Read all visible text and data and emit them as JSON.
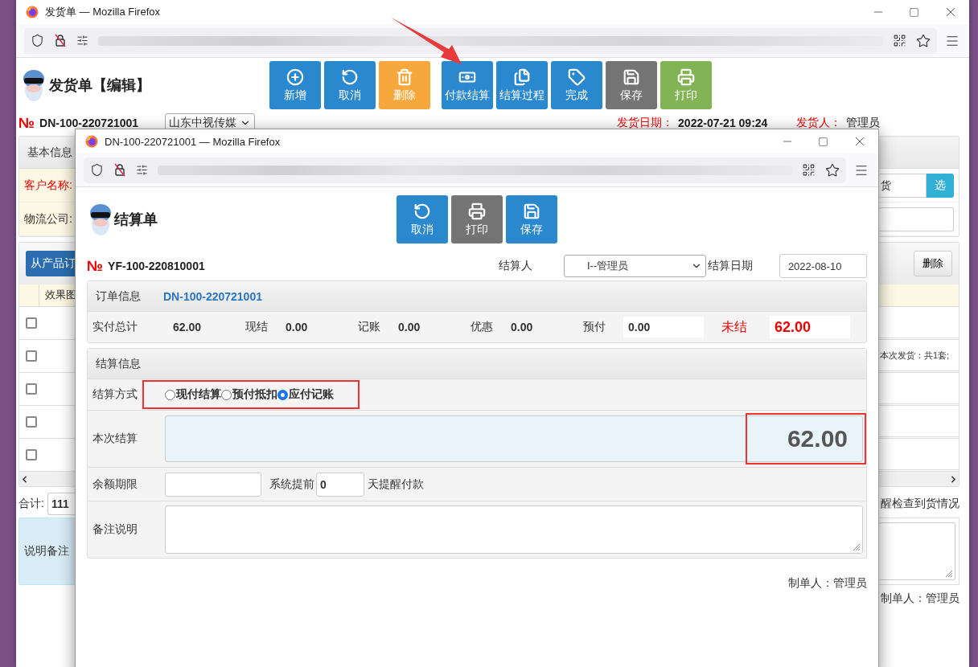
{
  "main_window": {
    "title": "发货单 — Mozilla Firefox",
    "page_title": "发货单【编辑】",
    "toolbar": [
      {
        "label": "新增",
        "color": "#2a88cf"
      },
      {
        "label": "取消",
        "color": "#2a88cf"
      },
      {
        "label": "删除",
        "color": "#f7a83c"
      },
      {
        "label": "付款结算",
        "color": "#2a88cf"
      },
      {
        "label": "结算过程",
        "color": "#2a88cf"
      },
      {
        "label": "完成",
        "color": "#2a88cf"
      },
      {
        "label": "保存",
        "color": "#747474"
      },
      {
        "label": "打印",
        "color": "#82b455"
      }
    ],
    "no_sign": "№",
    "number": "DN-100-220721001",
    "customer_select": "山东中视传媒",
    "ship_date_label": "发货日期：",
    "ship_date": "2022-07-21 09:24",
    "shipper_label": "发货人：",
    "shipper": "管理员",
    "basic_info": {
      "title": "基本信息",
      "fields": [
        {
          "label": "客户名称:",
          "required": true
        },
        {
          "label": "物流公司:",
          "required": false
        }
      ],
      "customer_value": "货",
      "pick_button": "选"
    },
    "products": {
      "add_button": "从产品订",
      "delete_button": "删除",
      "column_1": "效果图",
      "rows": [
        {
          "checked": false
        },
        {
          "checked": false,
          "note": "本次发货：共1套;"
        },
        {
          "checked": false
        },
        {
          "checked": false
        },
        {
          "checked": false
        }
      ]
    },
    "total_label": "合计:",
    "total_value": "111",
    "reminder_text": "醒检查到货情况",
    "remarks_label": "说明备注",
    "creator": "制单人：管理员"
  },
  "popup": {
    "title": "DN-100-220721001 — Mozilla Firefox",
    "page_title": "结算单",
    "toolbar": [
      {
        "label": "取消",
        "color": "#2a88cf"
      },
      {
        "label": "打印",
        "color": "#747474"
      },
      {
        "label": "保存",
        "color": "#2a88cf"
      }
    ],
    "no_sign": "№",
    "number": "YF-100-220810001",
    "settler_label": "结算人",
    "settler": "I--管理员",
    "date_label": "结算日期",
    "date": "2022-08-10",
    "order_info": {
      "title": "订单信息",
      "order_link": "DN-100-220721001",
      "totals": [
        {
          "label": "实付总计",
          "value": "62.00",
          "kind": "text"
        },
        {
          "label": "现结",
          "value": "0.00",
          "kind": "text"
        },
        {
          "label": "记账",
          "value": "0.00",
          "kind": "text"
        },
        {
          "label": "优惠",
          "value": "0.00",
          "kind": "text"
        },
        {
          "label": "预付",
          "value": "0.00",
          "kind": "input"
        },
        {
          "label": "未结",
          "value": "62.00",
          "kind": "due"
        }
      ]
    },
    "settlement": {
      "title": "结算信息",
      "method_label": "结算方式",
      "methods": [
        {
          "label": "现付结算",
          "selected": false
        },
        {
          "label": "预付抵扣",
          "selected": false
        },
        {
          "label": "应付记账",
          "selected": true
        }
      ],
      "amount_label": "本次结算",
      "amount": "62.00",
      "term_label": "余额期限",
      "remind_before": "系统提前",
      "remind_days": "0",
      "remind_after": "天提醒付款",
      "remarks_label": "备注说明"
    },
    "creator": "制单人：管理员"
  }
}
